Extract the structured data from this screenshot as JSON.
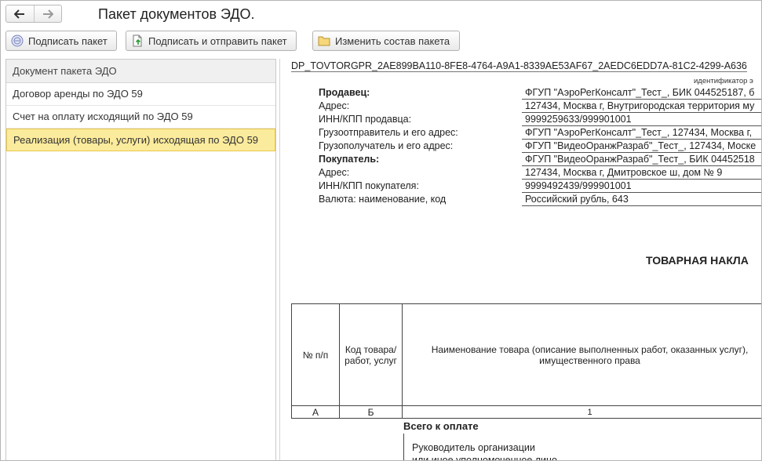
{
  "window": {
    "title": "Пакет документов ЭДО."
  },
  "toolbar": {
    "sign_label": "Подписать пакет",
    "sign_send_label": "Подписать и отправить пакет",
    "change_label": "Изменить состав пакета"
  },
  "list": {
    "header": "Документ пакета ЭДО",
    "items": [
      {
        "label": "Договор аренды по ЭДО 59"
      },
      {
        "label": "Счет на оплату исходящий по ЭДО 59"
      },
      {
        "label": "Реализация (товары, услуги) исходящая по ЭДО 59",
        "selected": true
      }
    ],
    "selected_color": "#fbeb9c"
  },
  "document": {
    "id_line": "DP_TOVTORGPR_2AE899BA110-8FE8-4764-A9A1-8339AE53AF67_2AEDC6EDD7A-81C2-4299-A636",
    "hint": "идентификатор э",
    "rows": [
      {
        "label": "Продавец:",
        "value": "ФГУП \"АэроРегКонсалт\"_Тест_, БИК 044525187, б"
      },
      {
        "label": "Адрес:",
        "value": "127434, Москва г, Внутригородская территория му"
      },
      {
        "label": "ИНН/КПП продавца:",
        "value": "9999259633/999901001"
      },
      {
        "label": "Грузоотправитель и его адрес:",
        "value": "ФГУП \"АэроРегКонсалт\"_Тест_, 127434, Москва г,"
      },
      {
        "label": "Грузополучатель и его адрес:",
        "value": "ФГУП \"ВидеоОранжРазраб\"_Тест_, 127434, Моске"
      },
      {
        "label": "Покупатель:",
        "value": "ФГУП \"ВидеоОранжРазраб\"_Тест_, БИК 04452518"
      },
      {
        "label": "Адрес:",
        "value": "127434, Москва г, Дмитровское ш, дом № 9"
      },
      {
        "label": "ИНН/КПП покупателя:",
        "value": "9999492439/999901001"
      },
      {
        "label": "Валюта: наименование, код",
        "value": "Российский рубль, 643"
      }
    ],
    "title": "ТОВАРНАЯ НАКЛА",
    "table": {
      "col1_header": "№ п/п",
      "col2_header": "Код товара/ работ, услуг",
      "col3_header": "Наименование товара (описание выполненных работ, оказанных услуг), имущественного права",
      "col1_code": "А",
      "col2_code": "Б",
      "col3_code": "1"
    },
    "total_label": "Всего к оплате",
    "sign_line1": "Руководитель организации",
    "sign_line2": "или иное уполномоченное лицо"
  }
}
